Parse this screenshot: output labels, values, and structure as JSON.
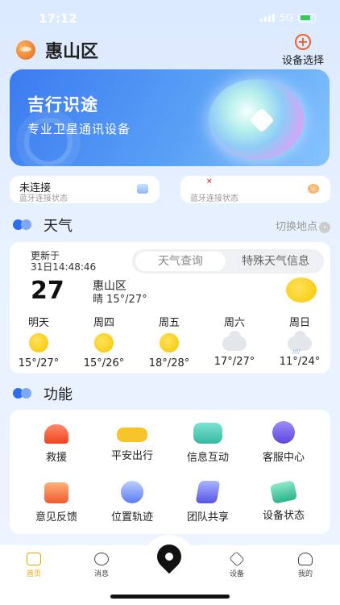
{
  "status_bar": {
    "time": "17:12",
    "network": "5G"
  },
  "header": {
    "city": "惠山区",
    "device_select_label": "设备选择"
  },
  "banner": {
    "title": "吉行识途",
    "subtitle": "专业卫星通讯设备"
  },
  "connection": {
    "left": {
      "status": "未连接",
      "sublabel": "蓝牙连接状态"
    },
    "right": {
      "sublabel": "蓝牙连接状态"
    }
  },
  "weather_section": {
    "title": "天气",
    "switch_label": "切换地点"
  },
  "weather": {
    "update_label": "更新于",
    "update_time": "31日14:48:46",
    "tabs": [
      "天气查询",
      "特殊天气信息"
    ],
    "current_temp": "27",
    "city": "惠山区",
    "description": "晴 15°/27°",
    "forecast": [
      {
        "day": "明天",
        "icon": "sun-icon",
        "range": "15°/27°"
      },
      {
        "day": "周四",
        "icon": "sun-icon",
        "range": "15°/26°"
      },
      {
        "day": "周五",
        "icon": "sun-icon",
        "range": "18°/28°"
      },
      {
        "day": "周六",
        "icon": "cloud-icon",
        "range": "17°/27°"
      },
      {
        "day": "周日",
        "icon": "rain-cloud-icon",
        "range": "11°/24°"
      }
    ]
  },
  "functions_section": {
    "title": "功能"
  },
  "functions": [
    {
      "label": "救援",
      "icon": "rescue-alarm-icon"
    },
    {
      "label": "平安出行",
      "icon": "car-icon"
    },
    {
      "label": "信息互动",
      "icon": "chat-icon"
    },
    {
      "label": "客服中心",
      "icon": "customer-service-icon"
    },
    {
      "label": "意见反馈",
      "icon": "feedback-box-icon"
    },
    {
      "label": "位置轨迹",
      "icon": "location-track-icon"
    },
    {
      "label": "团队共享",
      "icon": "team-share-icon"
    },
    {
      "label": "设备状态",
      "icon": "device-status-icon"
    }
  ],
  "bottom_nav": [
    {
      "label": "首页",
      "icon": "home-icon",
      "active": true
    },
    {
      "label": "消息",
      "icon": "message-icon",
      "active": false
    },
    {
      "label": "设备",
      "icon": "layers-icon",
      "active": false
    },
    {
      "label": "我的",
      "icon": "user-icon",
      "active": false
    }
  ],
  "colors": {
    "accent": "#f5a300",
    "brand_blue": "#3c7bf0",
    "plus_orange": "#f0632a"
  }
}
